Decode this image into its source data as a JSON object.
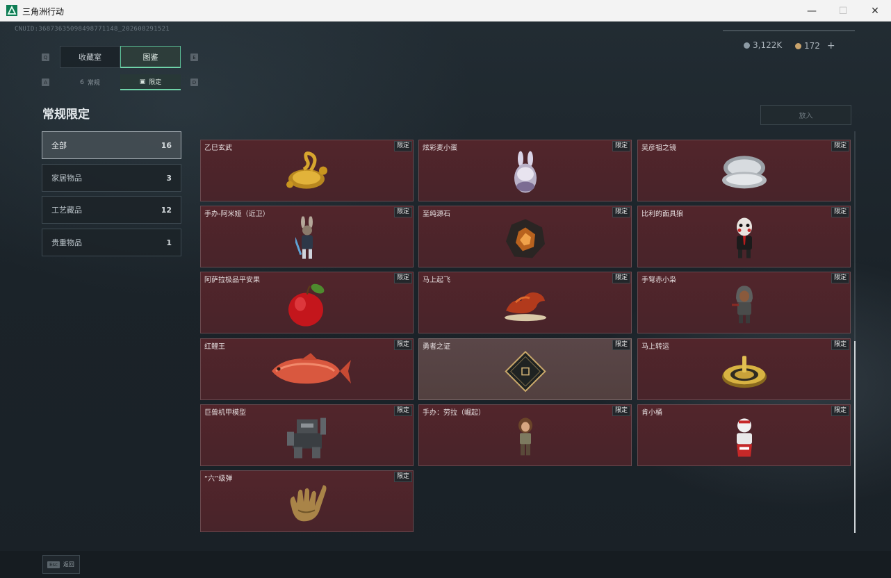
{
  "window": {
    "title": "三角洲行动",
    "controls": {
      "minimize": "—",
      "maximize": "☐",
      "close": "✕"
    }
  },
  "header": {
    "uid": "CNUID:36873635098498771148_202608291521",
    "currency": [
      {
        "icon": "silver-coin-icon",
        "value": "3,122K"
      },
      {
        "icon": "gold-coin-icon",
        "value": "172"
      }
    ],
    "add_label": "+"
  },
  "tabs": {
    "main": [
      {
        "label": "收藏室",
        "active": false
      },
      {
        "label": "图鉴",
        "active": true
      }
    ],
    "main_keys": {
      "left": "Q",
      "right": "E"
    },
    "sub": [
      {
        "icon": "6",
        "label": "常规",
        "active": false
      },
      {
        "icon": "▣",
        "label": "限定",
        "active": true
      }
    ],
    "sub_keys": {
      "left": "A",
      "right": "D"
    }
  },
  "section_title": "常规限定",
  "categories": [
    {
      "label": "全部",
      "count": "16",
      "active": true
    },
    {
      "label": "家居物品",
      "count": "3",
      "active": false
    },
    {
      "label": "工艺藏品",
      "count": "12",
      "active": false
    },
    {
      "label": "贵重物品",
      "count": "1",
      "active": false
    }
  ],
  "put_button": "放入",
  "tag_label": "限定",
  "items": [
    {
      "name": "乙巳玄武",
      "icon": "golden-serpent-turtle-icon"
    },
    {
      "name": "炫彩麦小蛋",
      "icon": "bunny-egg-icon"
    },
    {
      "name": "吴彦祖之镜",
      "icon": "compact-mirror-icon"
    },
    {
      "name": "手办-阿米娅（近卫）",
      "icon": "amiya-figure-icon"
    },
    {
      "name": "至纯源石",
      "icon": "originium-stone-icon"
    },
    {
      "name": "比利的面具狼",
      "icon": "billy-puppet-icon"
    },
    {
      "name": "阿萨拉极品平安果",
      "icon": "red-apple-icon"
    },
    {
      "name": "马上起飞",
      "icon": "red-horse-icon"
    },
    {
      "name": "手弩赤小枭",
      "icon": "hooded-figure-icon"
    },
    {
      "name": "红鲤王",
      "icon": "red-carp-icon"
    },
    {
      "name": "勇者之证",
      "icon": "hero-card-icon"
    },
    {
      "name": "马上转运",
      "icon": "golden-compass-icon"
    },
    {
      "name": "巨兽机甲模型",
      "icon": "mech-model-icon"
    },
    {
      "name": "手办：劳拉（崛起）",
      "icon": "lara-figure-icon"
    },
    {
      "name": "肯小桶",
      "icon": "bucket-mascot-icon"
    },
    {
      "name": "“六”级弹",
      "icon": "golden-hand-icon"
    }
  ],
  "footer": {
    "esc_key": "Esc",
    "back_label": "返回"
  }
}
